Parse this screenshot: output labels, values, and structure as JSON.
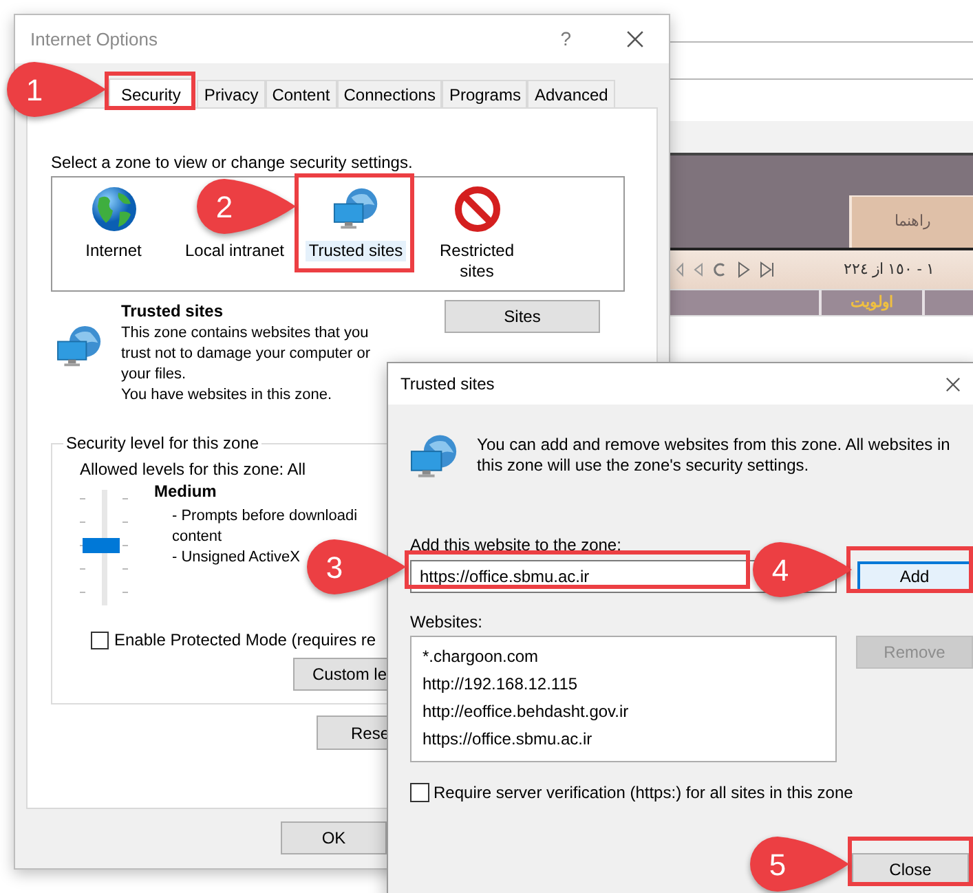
{
  "background_page": {
    "tab_label": "راهنما",
    "pager": "١ - ١٥٠ از ٢٢٤",
    "column_header": "اولویت"
  },
  "internet_options": {
    "title": "Internet Options",
    "help": "?",
    "tabs": [
      {
        "label": "Security",
        "selected": true
      },
      {
        "label": "Privacy",
        "selected": false
      },
      {
        "label": "Content",
        "selected": false
      },
      {
        "label": "Connections",
        "selected": false
      },
      {
        "label": "Programs",
        "selected": false
      },
      {
        "label": "Advanced",
        "selected": false
      }
    ],
    "zone_prompt": "Select a zone to view or change security settings.",
    "zones": [
      {
        "kind": "internet",
        "label": "Internet",
        "selected": false
      },
      {
        "kind": "intranet",
        "label": "Local intranet",
        "selected": false
      },
      {
        "kind": "trusted",
        "label": "Trusted sites",
        "selected": true
      },
      {
        "kind": "restricted",
        "label": "Restricted sites",
        "selected": false
      }
    ],
    "zone_title": "Trusted sites",
    "zone_description": "This zone contains websites that you trust not to damage your computer or your files.",
    "zone_note": "You have websites in this zone.",
    "sites_button": "Sites",
    "security_level": {
      "group_title": "Security level for this zone",
      "allowed": "Allowed levels for this zone: All",
      "level": 0.5,
      "level_name": "Medium",
      "bullets": [
        "- Prompts before downloadi",
        "content",
        "- Unsigned ActiveX"
      ]
    },
    "protected_mode": {
      "label": "Enable Protected Mode (requires re",
      "checked": false
    },
    "custom_button": "Custom le",
    "reset_button": "Rese",
    "ok_button": "OK"
  },
  "trusted_dialog": {
    "title": "Trusted sites",
    "info": "You can add and remove websites from this zone. All websites in this zone will use the zone's security settings.",
    "add_label": "Add this website to the zone:",
    "input_value": "https://office.sbmu.ac.ir",
    "add_button": "Add",
    "websites_label": "Websites:",
    "websites": [
      "*.chargoon.com",
      "http://192.168.12.115",
      "http://eoffice.behdasht.gov.ir",
      "https://office.sbmu.ac.ir"
    ],
    "remove_button": {
      "label": "Remove",
      "disabled": true
    },
    "require_https": {
      "label": "Require server verification (https:) for all sites in this zone",
      "checked": false
    },
    "close_button": "Close"
  },
  "callouts": [
    {
      "number": "1"
    },
    {
      "number": "2"
    },
    {
      "number": "3"
    },
    {
      "number": "4"
    },
    {
      "number": "5"
    }
  ]
}
